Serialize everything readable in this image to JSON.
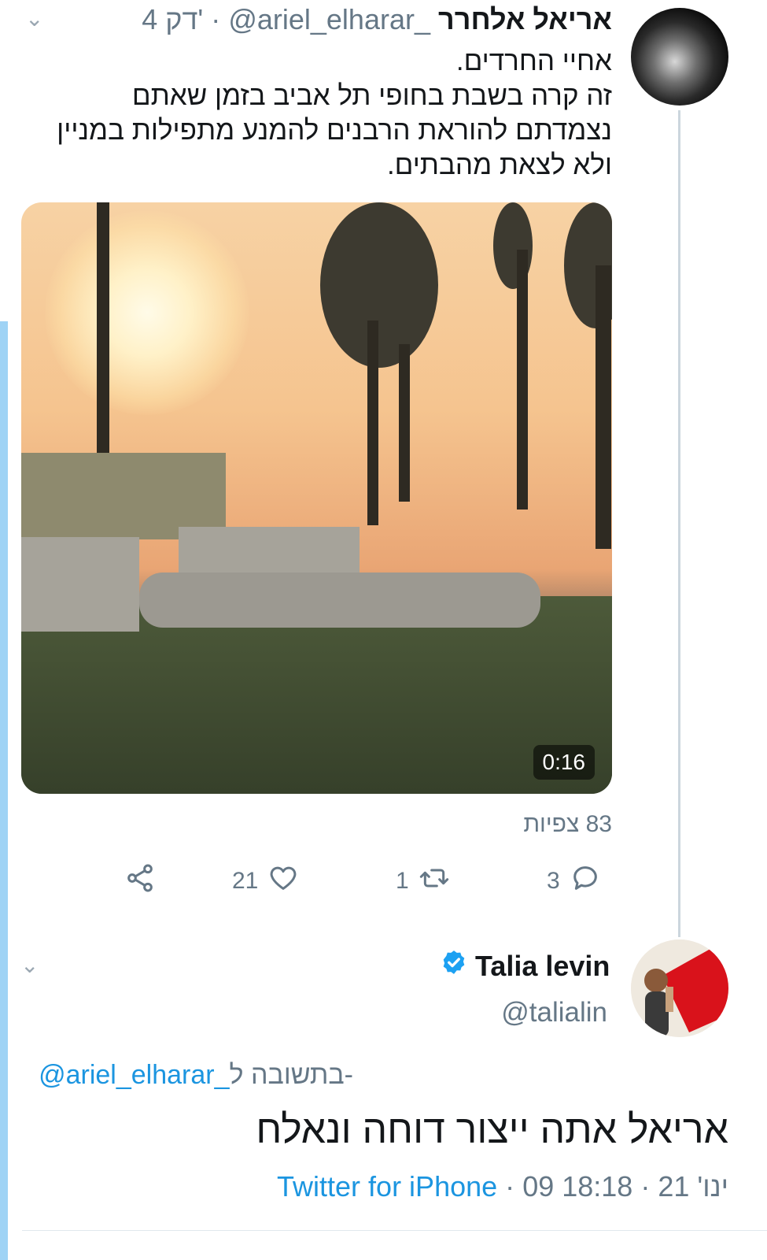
{
  "tweet1": {
    "name": "אריאל אלחרר",
    "handle": "@ariel_elharar_",
    "time": "4 דק'",
    "separator": "·",
    "text_lines": [
      "אחיי החרדים.",
      "זה קרה בשבת בחופי תל אביב בזמן שאתם",
      "נצמדתם להוראת הרבנים להמנע מתפילות במניין",
      "ולא לצאת מהבתים."
    ],
    "video_duration": "0:16",
    "views": "83 צפיות",
    "actions": {
      "reply_count": "3",
      "retweet_count": "1",
      "like_count": "21"
    }
  },
  "tweet2": {
    "name": "Talia levin",
    "verified": true,
    "handle": "@talialin",
    "reply_prefix": "בתשובה ל-",
    "reply_handle": "@ariel_elharar_",
    "text": "אריאל אתה ייצור דוחה ונאלח",
    "time": "18:18",
    "date": "09 ינו' 21",
    "source": "Twitter for iPhone",
    "separator": "·"
  },
  "colors": {
    "link": "#1b95e0",
    "secondary_text": "#657786",
    "thread_line": "#ccd6dd",
    "left_accent": "#9fd3f5"
  },
  "icons": [
    "chevron-down-icon",
    "reply-icon",
    "retweet-icon",
    "like-icon",
    "share-icon",
    "verified-badge-icon"
  ]
}
